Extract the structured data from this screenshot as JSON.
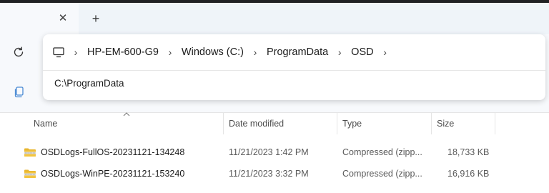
{
  "tabs": {
    "close_glyph": "✕",
    "new_tab_glyph": "+"
  },
  "address_bar": {
    "breadcrumbs": [
      "HP-EM-600-G9",
      "Windows (C:)",
      "ProgramData",
      "OSD"
    ],
    "separator": "›",
    "suggestion": "C:\\ProgramData"
  },
  "file_list": {
    "columns": [
      {
        "label": "Name"
      },
      {
        "label": "Date modified"
      },
      {
        "label": "Type"
      },
      {
        "label": "Size"
      }
    ],
    "rows": [
      {
        "name": "OSDLogs-FullOS-20231121-134248",
        "date": "11/21/2023 1:42 PM",
        "type": "Compressed (zipp...",
        "size": "18,733 KB"
      },
      {
        "name": "OSDLogs-WinPE-20231121-153240",
        "date": "11/21/2023 3:32 PM",
        "type": "Compressed (zipp...",
        "size": "16,916 KB"
      }
    ]
  },
  "icons": {
    "refresh": "refresh-icon",
    "computer": "computer-icon",
    "copy": "copy-icon",
    "zip_folder": "zip-folder-icon"
  },
  "colors": {
    "chrome_bg": "#f7f9fc",
    "tab_strip": "#eff4f9",
    "folder_yellow": "#f3c540"
  }
}
